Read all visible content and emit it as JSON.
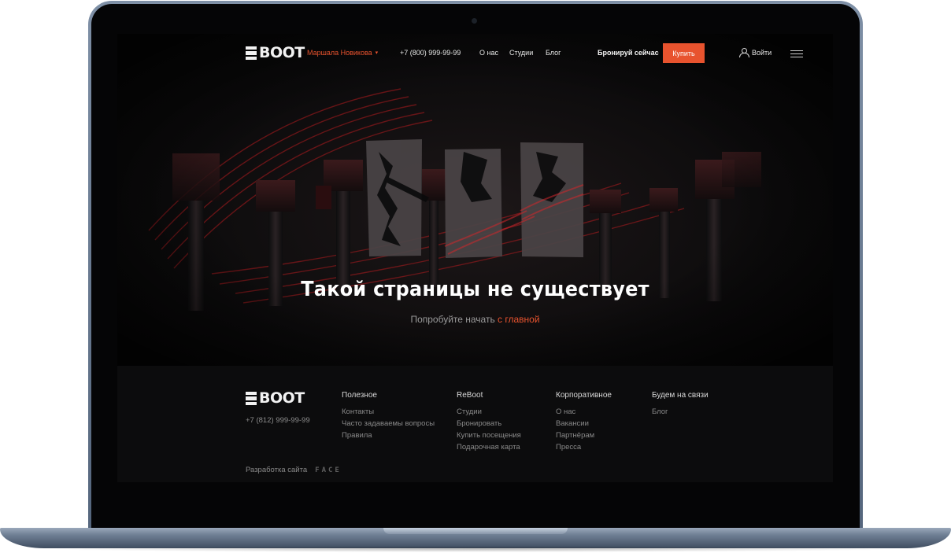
{
  "brand": {
    "logo_text": "BOOT",
    "accent": "#e8532e"
  },
  "header": {
    "studio": "Маршала Новикова",
    "phone": "+7 (800) 999-99-99",
    "nav": [
      "О нас",
      "Студии",
      "Блог"
    ],
    "book_now": "Бронируй сейчас",
    "buy": "Купить",
    "login": "Войти"
  },
  "hero": {
    "title": "Такой страницы не существует",
    "subtitle_prefix": "Попробуйте начать ",
    "subtitle_link": "с главной"
  },
  "footer": {
    "phone": "+7 (812) 999-99-99",
    "columns": [
      {
        "title": "Полезное",
        "items": [
          "Контакты",
          "Часто задаваемы вопросы",
          "Правила"
        ]
      },
      {
        "title": "ReBoot",
        "items": [
          "Студии",
          "Бронировать",
          "Купить посещения",
          "Подарочная карта"
        ]
      },
      {
        "title": "Корпоративное",
        "items": [
          "О нас",
          "Вакансии",
          "Партнёрам",
          "Пресса"
        ]
      },
      {
        "title": "Будем на связи",
        "items": [
          "Блог"
        ]
      }
    ],
    "developer_label": "Разработка сайта",
    "developer_logo": "FACE"
  }
}
